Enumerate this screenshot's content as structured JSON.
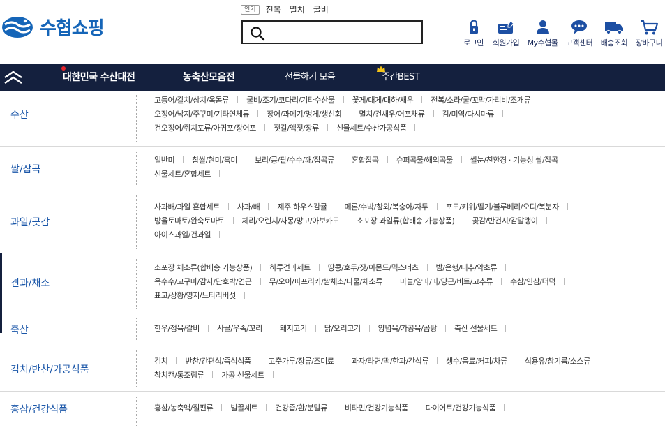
{
  "brand": {
    "name": "수협쇼핑",
    "color": "#1565b8"
  },
  "popular": {
    "badge": "인기",
    "keywords": [
      "전복",
      "멸치",
      "굴비"
    ]
  },
  "search": {
    "placeholder": "",
    "value": ""
  },
  "utils": [
    {
      "label": "로그인",
      "icon": "lock-icon"
    },
    {
      "label": "회원가입",
      "icon": "member-card-icon"
    },
    {
      "label": "My수협몰",
      "icon": "person-icon"
    },
    {
      "label": "고객센터",
      "icon": "chat-icon"
    },
    {
      "label": "배송조회",
      "icon": "truck-icon"
    },
    {
      "label": "장바구니",
      "icon": "cart-icon"
    }
  ],
  "nav": {
    "background": "#14203e",
    "items": [
      "대한민국 수산대전",
      "농축산모음전",
      "선물하기 모음",
      "주간BEST"
    ]
  },
  "categories": [
    {
      "name": "수산",
      "lines": [
        [
          "고등어/갈치/삼치/옥돔류",
          "굴비/조기/코다리/기타수산물",
          "꽃게/대게/대하/새우",
          "전복/소라/굴/꼬막/가리비/조개류"
        ],
        [
          "오징어/낙지/주꾸미/기타연체류",
          "장어/과메기/멍게/생선회",
          "멸치/건새우/어포채류",
          "김/미역/다시마류"
        ],
        [
          "건오징어/쥐치포류/아귀포/장어포",
          "젓갈/액젓/장류",
          "선물세트/수산가공식품"
        ]
      ]
    },
    {
      "name": "쌀/잡곡",
      "lines": [
        [
          "일반미",
          "찹쌀/현미/흑미",
          "보리/콩/팥/수수/깨/잡곡류",
          "혼합잡곡",
          "슈퍼곡물/해외곡물",
          "쌀눈/친환경 · 기능성 쌀/잡곡"
        ],
        [
          "선물세트/혼합세트"
        ]
      ]
    },
    {
      "name": "과일/곶감",
      "lines": [
        [
          "사과배/과일 혼합세트",
          "사과/배",
          "제주 하우스감귤",
          "메론/수박/참외/복숭아/자두",
          "포도/키위/딸기/블루베리/오디/복분자"
        ],
        [
          "방울토마토/완숙토마토",
          "체리/오렌지/자몽/망고/아보카도",
          "소포장 과일류(합배송 가능상품)",
          "곶감/반건시/감말랭이"
        ],
        [
          "아이스과일/건과일"
        ]
      ]
    },
    {
      "name": "견과/채소",
      "lines": [
        [
          "소포장 채소류(합배송 가능상품)",
          "하루견과세트",
          "땅콩/호두/잣/아몬드/믹스너츠",
          "밤/은행/대추/약초류"
        ],
        [
          "옥수수/고구마/감자/단호박/연근",
          "무/오이/파프리카/쌈채소/나물/채소류",
          "마늘/양파/파/당근/비트/고추류",
          "수삼/인삼/더덕"
        ],
        [
          "표고/상황/영지/느타리버섯"
        ]
      ]
    },
    {
      "name": "축산",
      "lines": [
        [
          "한우/정육/갈비",
          "사골/우족/꼬리",
          "돼지고기",
          "닭/오리고기",
          "양념육/가공육/곰탕",
          "축산 선물세트"
        ]
      ]
    },
    {
      "name": "김치/반찬/가공식품",
      "lines": [
        [
          "김치",
          "반찬/간편식/즉석식품",
          "고춧가루/장류/조미료",
          "과자/라면/떡/한과/간식류",
          "생수/음료/커피/차류",
          "식용유/참기름/소스류"
        ],
        [
          "참치캔/통조림류",
          "가공 선물세트"
        ]
      ]
    },
    {
      "name": "홍삼/건강식품",
      "lines": [
        [
          "홍삼/농축액/절편류",
          "벌꿀세트",
          "건강즙/환/분말류",
          "비타민/건강기능식품",
          "다이어트/건강기능식품"
        ]
      ]
    }
  ]
}
